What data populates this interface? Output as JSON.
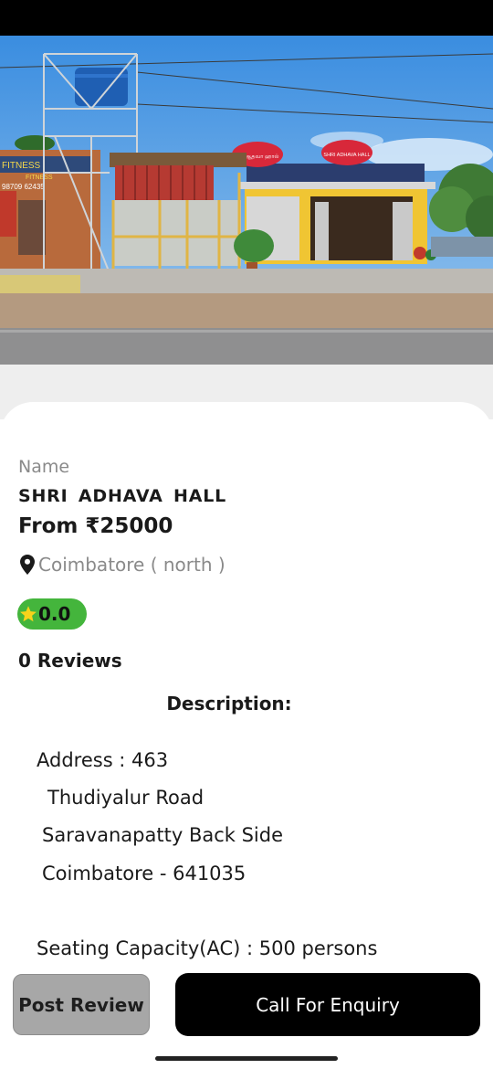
{
  "hero": {
    "sign_left": "ஸ்ரீ ஆதவா ஹால்",
    "sign_right": "SHRI ADHAVA HALL",
    "side_sign": "FITNESS",
    "side_sign_2": "FITNESS",
    "side_sign_phone": "98709 62435"
  },
  "details": {
    "name_label": "Name",
    "hall_name": "SHRI  ADHAVA  HALL",
    "price": "From ₹25000",
    "location": "Coimbatore ( north )",
    "rating": "0.0",
    "reviews": "0 Reviews",
    "description_title": "Description:"
  },
  "description_lines": [
    "Address : 463",
    "Thudiyalur Road",
    "Saravanapatty Back Side",
    "Coimbatore - 641035",
    "Seating Capacity(AC) : 500 persons"
  ],
  "actions": {
    "post_review": "Post Review",
    "call_enquiry": "Call For Enquiry"
  },
  "colors": {
    "rating_badge": "#44b53c",
    "primary_button": "#000000",
    "secondary_button": "#a7a7a7"
  },
  "icons": {
    "location": "location-pin-icon",
    "rating": "star-icon"
  }
}
